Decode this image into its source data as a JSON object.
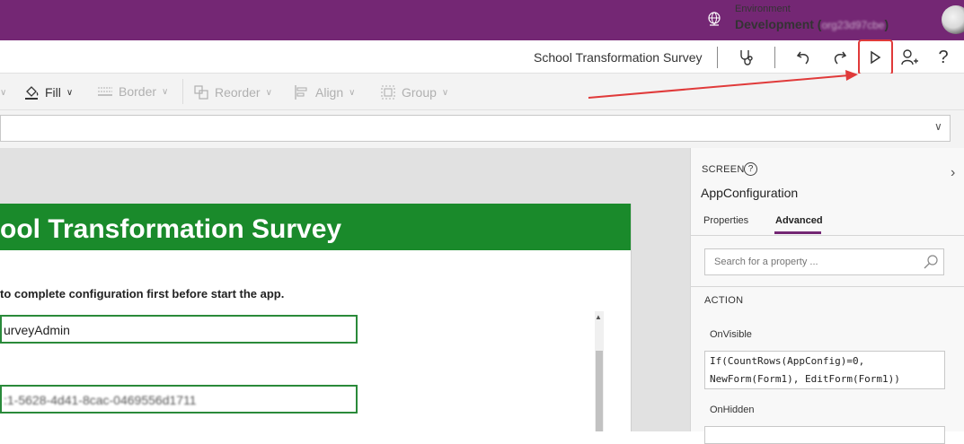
{
  "topbar": {
    "env_label": "Environment",
    "env_name": "Development (",
    "env_org": "org23d97cbe",
    "env_close": ")",
    "bg_color": "#742774"
  },
  "cmdbar": {
    "app_name": "School Transformation Survey",
    "icons": [
      "stethoscope-icon",
      "undo-icon",
      "redo-icon",
      "play-icon",
      "share-user-icon",
      "help-icon"
    ]
  },
  "ribbon": {
    "fill": "Fill",
    "border": "Border",
    "reorder": "Reorder",
    "align": "Align",
    "group": "Group"
  },
  "canvas": {
    "app_title": "ool Transformation Survey",
    "instruction": "to complete configuration first before start the app.",
    "field1_value": "urveyAdmin",
    "field2_value": ":1-5628-4d41-8cac-0469556d1711",
    "header_color": "#1a8a2b"
  },
  "panel": {
    "screen_label": "SCREEN",
    "help_glyph": "?",
    "screen_name": "AppConfiguration",
    "tabs": [
      {
        "label": "Properties",
        "active": false
      },
      {
        "label": "Advanced",
        "active": true
      }
    ],
    "search_placeholder": "Search for a property ...",
    "action_label": "ACTION",
    "onvisible_label": "OnVisible",
    "onvisible_code_line1": "If(CountRows(AppConfig)=0,",
    "onvisible_code_line2": "NewForm(Form1), EditForm(Form1))",
    "onhidden_label": "OnHidden"
  },
  "annotation": {
    "arrow_color": "#e03a3a"
  }
}
